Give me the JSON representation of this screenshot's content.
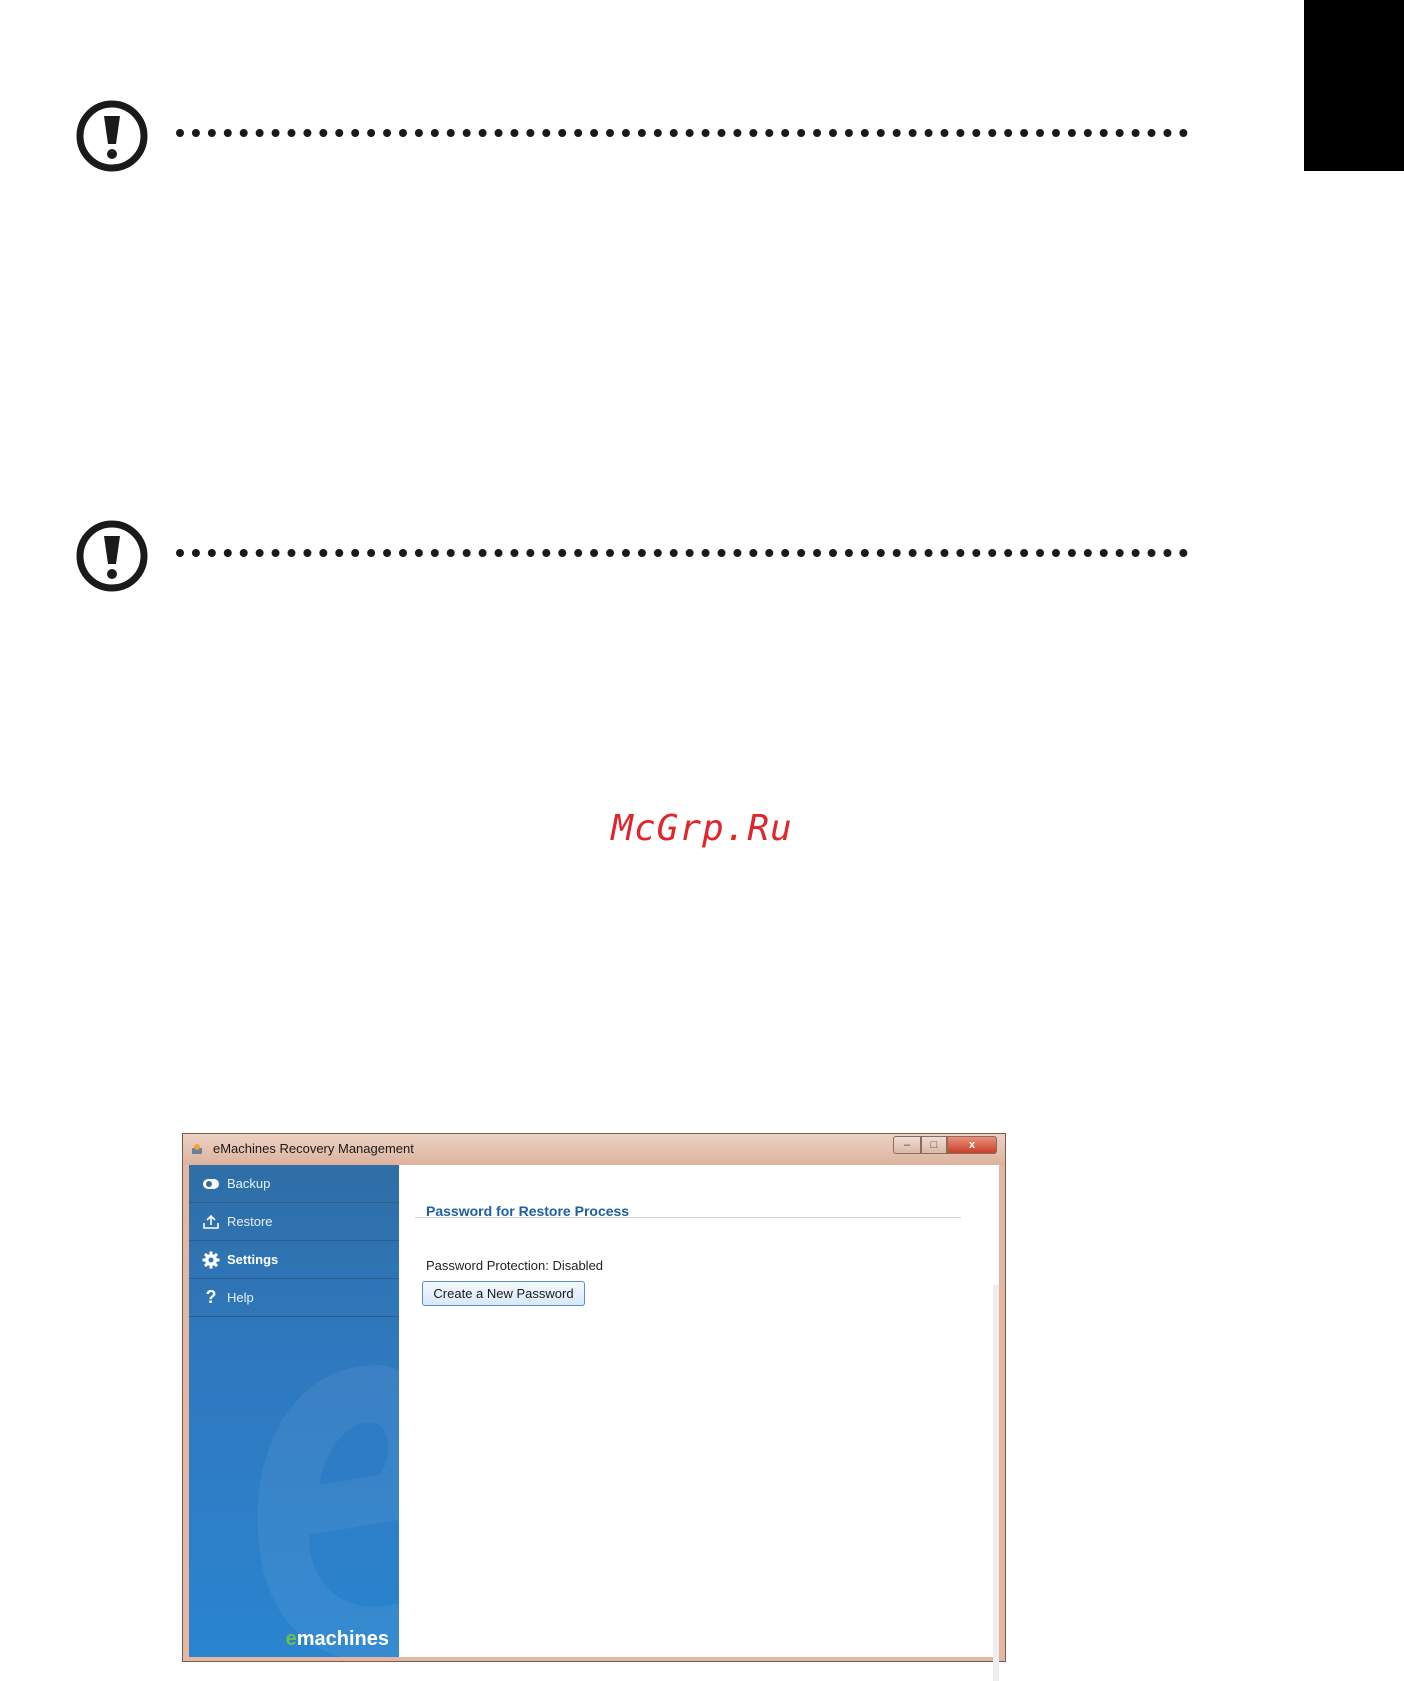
{
  "watermark": {
    "text": "McGrp.Ru",
    "color": "#e0252b"
  },
  "window": {
    "title": "eMachines Recovery Management",
    "controls": {
      "minimize": "–",
      "maximize": "□",
      "close": "x"
    },
    "sidebar": {
      "items": [
        {
          "label": "Backup",
          "icon": "backup-icon",
          "active": false
        },
        {
          "label": "Restore",
          "icon": "restore-icon",
          "active": false
        },
        {
          "label": "Settings",
          "icon": "gear-icon",
          "active": true
        },
        {
          "label": "Help",
          "icon": "question-icon",
          "active": false
        }
      ],
      "logo_prefix": "e",
      "logo_text": "machines"
    },
    "content": {
      "heading": "Password for Restore Process",
      "status": "Password Protection: Disabled",
      "button_label": "Create a New Password"
    }
  }
}
